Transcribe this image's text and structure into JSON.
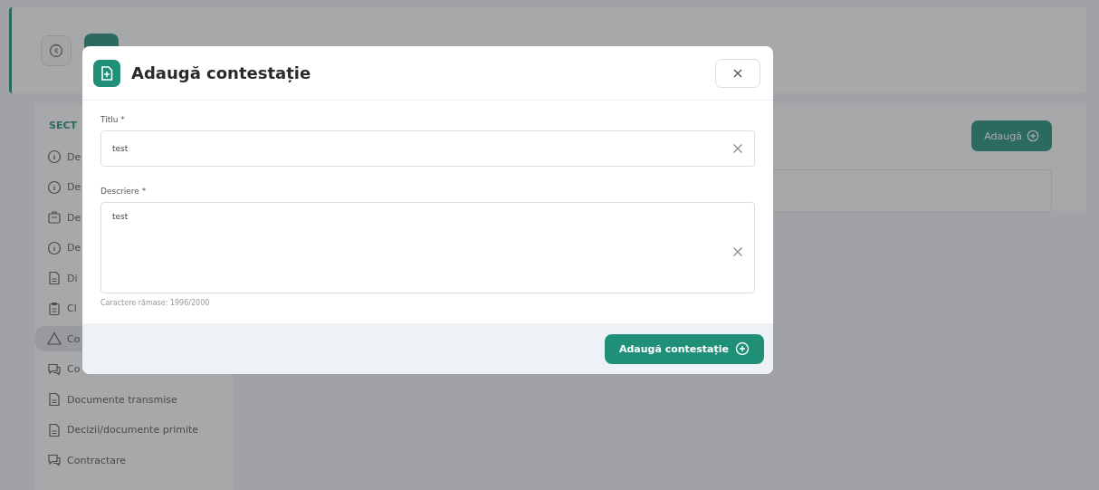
{
  "page": {
    "sidebar": {
      "heading": "SECT",
      "items": [
        {
          "label": "De",
          "selected": false
        },
        {
          "label": "De",
          "selected": false
        },
        {
          "label": "De",
          "selected": false
        },
        {
          "label": "De",
          "selected": false
        },
        {
          "label": "Di",
          "selected": false
        },
        {
          "label": "Cl",
          "selected": false
        },
        {
          "label": "Co",
          "selected": true
        },
        {
          "label": "Co",
          "selected": false
        },
        {
          "label": "Documente transmise",
          "selected": false
        },
        {
          "label": "Decizii/documente primite",
          "selected": false
        },
        {
          "label": "Contractare",
          "selected": false
        }
      ]
    },
    "add_button": "Adaugă"
  },
  "dialog": {
    "title": "Adaugă contestație",
    "fields": [
      {
        "label": "Titlu *",
        "value": "test",
        "kind": "input"
      },
      {
        "label": "Descriere *",
        "value": "test",
        "kind": "textarea"
      }
    ],
    "counter": "Caractere rămase: 1996/2000",
    "submit": "Adaugă contestație"
  }
}
